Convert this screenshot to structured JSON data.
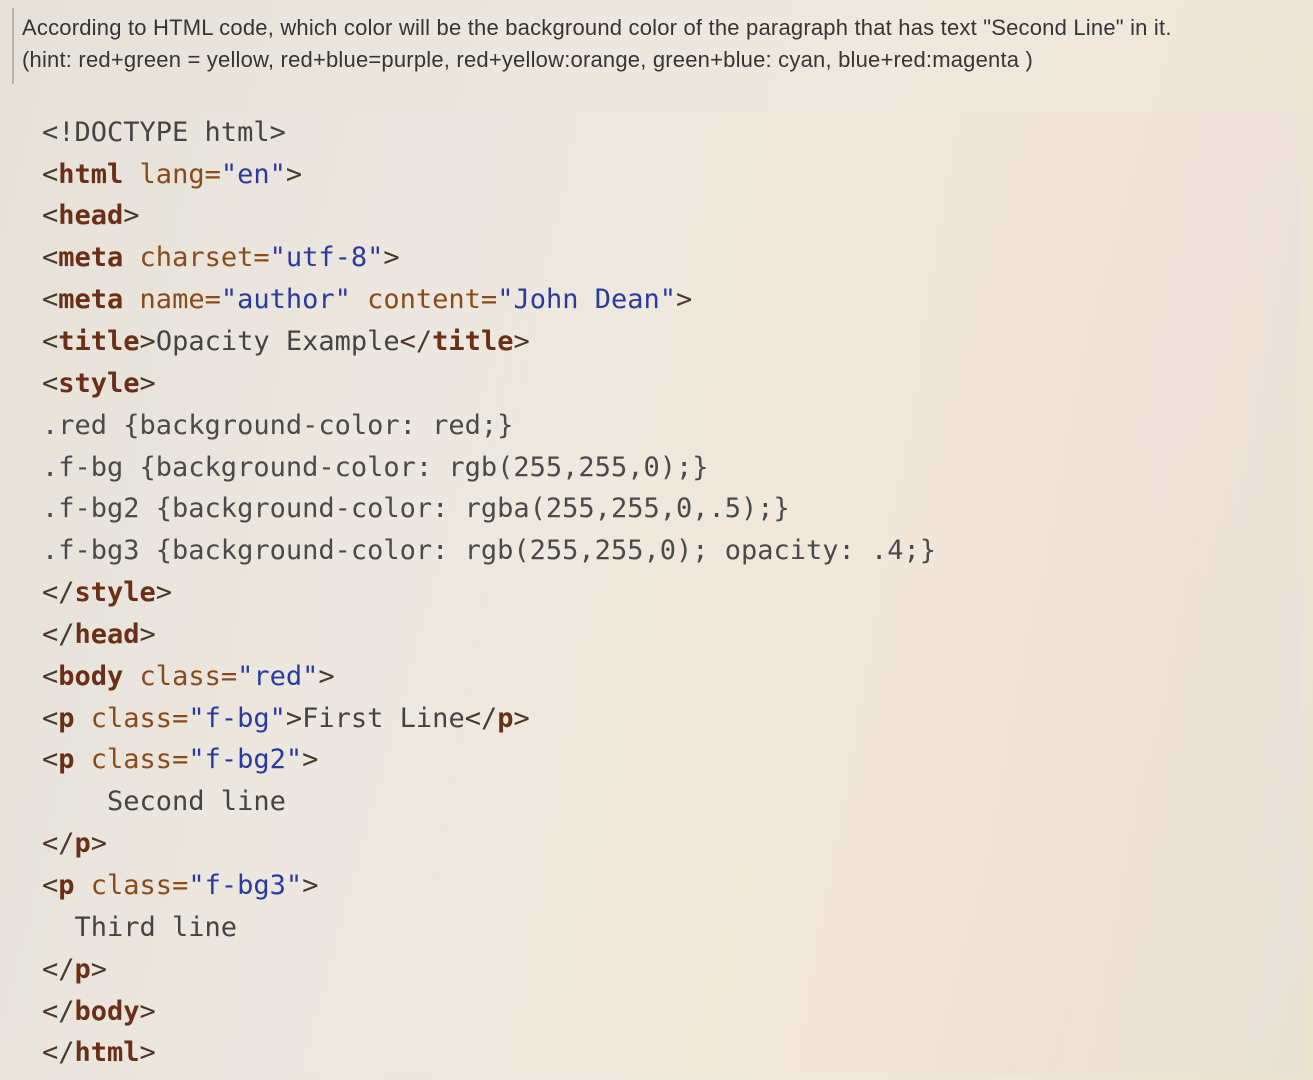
{
  "question": {
    "prompt": "According to HTML code, which color will be the background color of the paragraph that has text \"Second Line\" in it.",
    "hint": "(hint: red+green = yellow, red+blue=purple, red+yellow:orange, green+blue: cyan, blue+red:magenta   )"
  },
  "code": {
    "l01_doctype": "<!DOCTYPE html>",
    "l02_angle_open": "<",
    "l02_tag": "html",
    "l02_attr": " lang=",
    "l02_str": "\"en\"",
    "l02_angle_close": ">",
    "l03_open": "<",
    "l03_tag": "head",
    "l03_close": ">",
    "l04_open": "<",
    "l04_tag": "meta",
    "l04_attr": " charset=",
    "l04_str": "\"utf-8\"",
    "l04_close": ">",
    "l05_open": "<",
    "l05_tag": "meta",
    "l05_attr1": " name=",
    "l05_str1": "\"author\"",
    "l05_attr2": " content=",
    "l05_str2": "\"John Dean\"",
    "l05_close": ">",
    "l06_open": "<",
    "l06_tag": "title",
    "l06_close1": ">",
    "l06_text": "Opacity Example",
    "l06_open2": "</",
    "l06_tag2": "title",
    "l06_close2": ">",
    "l07_open": "<",
    "l07_tag": "style",
    "l07_close": ">",
    "l08": ".red {background-color: red;}",
    "l09": ".f-bg {background-color: rgb(255,255,0);}",
    "l10": ".f-bg2 {background-color: rgba(255,255,0,.5);}",
    "l11": ".f-bg3 {background-color: rgb(255,255,0); opacity: .4;}",
    "l12_open": "</",
    "l12_tag": "style",
    "l12_close": ">",
    "l13_open": "</",
    "l13_tag": "head",
    "l13_close": ">",
    "l14_open": "<",
    "l14_tag": "body",
    "l14_attr": " class=",
    "l14_str": "\"red\"",
    "l14_close": ">",
    "l15_open": "<",
    "l15_tag": "p",
    "l15_attr": " class=",
    "l15_str": "\"f-bg\"",
    "l15_close1": ">",
    "l15_text": "First Line",
    "l15_open2": "</",
    "l15_tag2": "p",
    "l15_close2": ">",
    "l16_open": "<",
    "l16_tag": "p",
    "l16_attr": " class=",
    "l16_str": "\"f-bg2\"",
    "l16_close": ">",
    "l17_text": "    Second line",
    "l18_open": "</",
    "l18_tag": "p",
    "l18_close": ">",
    "l19_open": "<",
    "l19_tag": "p",
    "l19_attr": " class=",
    "l19_str": "\"f-bg3\"",
    "l19_close": ">",
    "l20_text": "  Third line",
    "l21_open": "</",
    "l21_tag": "p",
    "l21_close": ">",
    "l22_open": "</",
    "l22_tag": "body",
    "l22_close": ">",
    "l23_open": "</",
    "l23_tag": "html",
    "l23_close": ">"
  }
}
